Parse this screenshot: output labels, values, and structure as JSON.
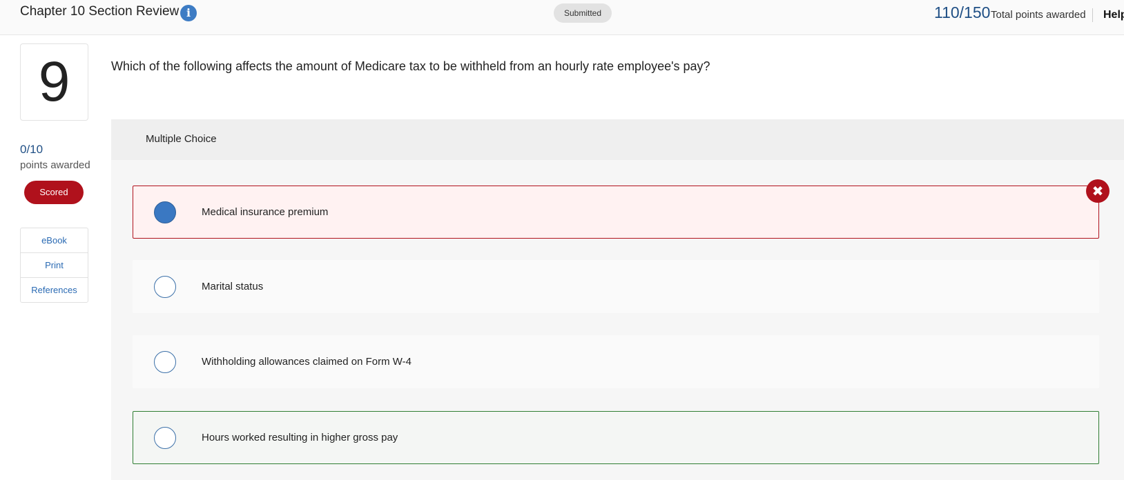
{
  "header": {
    "title": "Chapter 10 Section Review",
    "info_icon": "info-icon",
    "status_badge": "Submitted",
    "total_score": "110/150",
    "total_label": "Total points awarded",
    "help_label": "Help"
  },
  "sidebar": {
    "question_number": "9",
    "points_score": "0/10",
    "points_label": "points awarded",
    "scored_badge": "Scored",
    "links": [
      "eBook",
      "Print",
      "References"
    ]
  },
  "question": {
    "text": "Which of the following affects the amount of Medicare tax to be withheld from an hourly rate employee's pay?",
    "type_label": "Multiple Choice",
    "options": [
      {
        "label": "Medical insurance premium",
        "selected": true,
        "state": "incorrect"
      },
      {
        "label": "Marital status",
        "selected": false,
        "state": "neutral"
      },
      {
        "label": "Withholding allowances claimed on Form W-4",
        "selected": false,
        "state": "neutral"
      },
      {
        "label": "Hours worked resulting in higher gross pay",
        "selected": false,
        "state": "correct"
      }
    ],
    "incorrect_marker_icon": "close-circle-icon"
  },
  "colors": {
    "accent_blue": "#1f4f85",
    "incorrect_red": "#b0111c",
    "correct_green": "#2e7d32",
    "radio_blue": "#3a78c2"
  }
}
